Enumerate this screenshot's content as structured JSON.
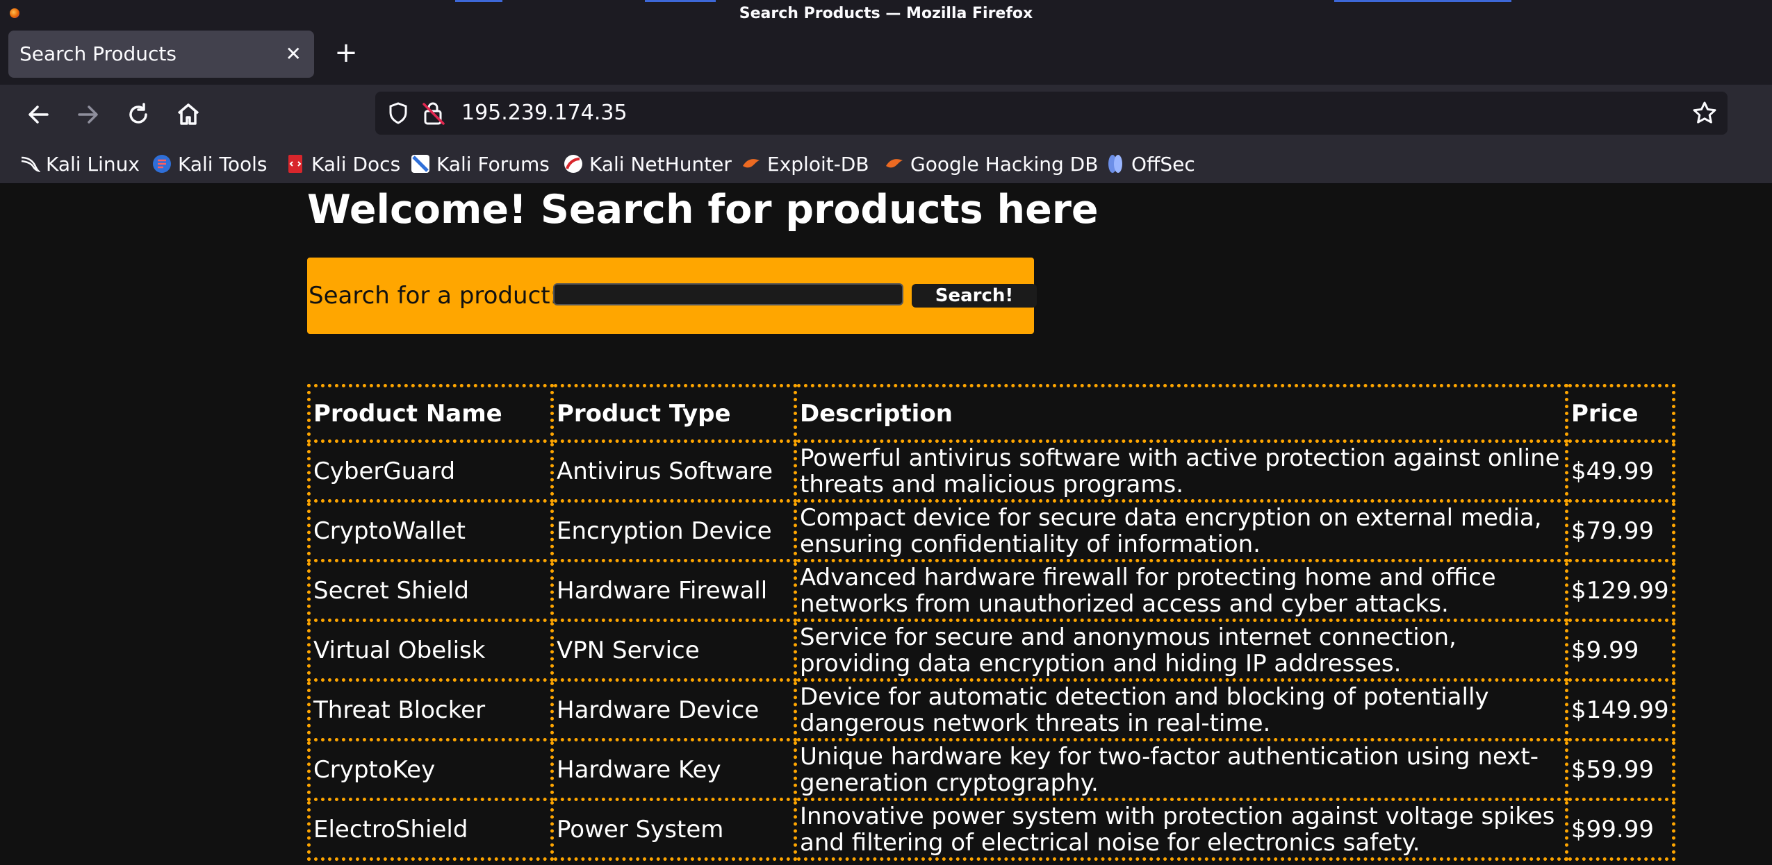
{
  "window": {
    "title": "Search Products — Mozilla Firefox"
  },
  "tab": {
    "label": "Search Products",
    "close_glyph": "✕",
    "new_tab_glyph": "+"
  },
  "navbar": {
    "url": "195.239.174.35"
  },
  "bookmarks": [
    {
      "label": "Kali Linux",
      "icon": "kali-dragon-icon"
    },
    {
      "label": "Kali Tools",
      "icon": "kali-tools-icon"
    },
    {
      "label": "Kali Docs",
      "icon": "kali-docs-icon"
    },
    {
      "label": "Kali Forums",
      "icon": "kali-forums-icon"
    },
    {
      "label": "Kali NetHunter",
      "icon": "kali-nethunter-icon"
    },
    {
      "label": "Exploit-DB",
      "icon": "exploit-db-icon"
    },
    {
      "label": "Google Hacking DB",
      "icon": "ghdb-icon"
    },
    {
      "label": "OffSec",
      "icon": "offsec-icon"
    }
  ],
  "page": {
    "heading": "Welcome! Search for products here",
    "search": {
      "label": "Search for a product:",
      "value": "",
      "button_label": "Search!"
    },
    "table": {
      "headers": [
        "Product Name",
        "Product Type",
        "Description",
        "Price"
      ],
      "rows": [
        [
          "CyberGuard",
          "Antivirus Software",
          "Powerful antivirus software with active protection against online threats and malicious programs.",
          "$49.99"
        ],
        [
          "CryptoWallet",
          "Encryption Device",
          "Compact device for secure data encryption on external media, ensuring confidentiality of information.",
          "$79.99"
        ],
        [
          "Secret Shield",
          "Hardware Firewall",
          "Advanced hardware firewall for protecting home and office networks from unauthorized access and cyber attacks.",
          "$129.99"
        ],
        [
          "Virtual Obelisk",
          "VPN Service",
          "Service for secure and anonymous internet connection, providing data encryption and hiding IP addresses.",
          "$9.99"
        ],
        [
          "Threat Blocker",
          "Hardware Device",
          "Device for automatic detection and blocking of potentially dangerous network threats in real-time.",
          "$149.99"
        ],
        [
          "CryptoKey",
          "Hardware Key",
          "Unique hardware key for two-factor authentication using next-generation cryptography.",
          "$59.99"
        ],
        [
          "ElectroShield",
          "Power System",
          "Innovative power system with protection against voltage spikes and filtering of electrical noise for electronics safety.",
          "$99.99"
        ]
      ]
    }
  },
  "colors": {
    "accent": "#ffa600",
    "page_bg": "#111111",
    "chrome_bg": "#2b2a33",
    "titlebar_bg": "#1c1b22"
  }
}
